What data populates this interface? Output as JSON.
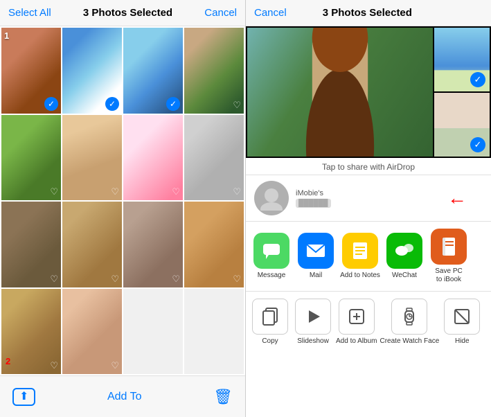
{
  "left": {
    "header": {
      "select_all": "Select All",
      "selected_count": "3 Photos Selected",
      "cancel": "Cancel"
    },
    "footer": {
      "add_to": "Add To",
      "number": "2"
    },
    "photos": [
      {
        "id": "p1",
        "selected": true,
        "heart": false,
        "number": "1"
      },
      {
        "id": "p2",
        "selected": true,
        "heart": false,
        "number": null
      },
      {
        "id": "p3",
        "selected": true,
        "heart": false,
        "number": null
      },
      {
        "id": "p4",
        "selected": false,
        "heart": true,
        "number": null
      },
      {
        "id": "p5",
        "selected": false,
        "heart": true,
        "number": null
      },
      {
        "id": "p6",
        "selected": false,
        "heart": true,
        "number": null
      },
      {
        "id": "p7",
        "selected": false,
        "heart": true,
        "number": null
      },
      {
        "id": "p8",
        "selected": false,
        "heart": true,
        "number": null
      },
      {
        "id": "p9",
        "selected": false,
        "heart": true,
        "number": null
      },
      {
        "id": "p10",
        "selected": false,
        "heart": true,
        "number": null
      },
      {
        "id": "p11",
        "selected": false,
        "heart": true,
        "number": null
      },
      {
        "id": "p12",
        "selected": false,
        "heart": true,
        "number": null
      },
      {
        "id": "p13",
        "selected": false,
        "heart": true,
        "number": null
      },
      {
        "id": "p14",
        "selected": false,
        "heart": true,
        "number": null
      }
    ]
  },
  "right": {
    "header": {
      "cancel": "Cancel",
      "selected_count": "3 Photos Selected"
    },
    "airdrop_label": "Tap to share with AirDrop",
    "contact": {
      "name": "iMobie's"
    },
    "apps": [
      {
        "id": "msg",
        "label": "Message",
        "icon": "💬"
      },
      {
        "id": "mail",
        "label": "Mail",
        "icon": "✉️"
      },
      {
        "id": "notes",
        "label": "Add to Notes",
        "icon": "📝"
      },
      {
        "id": "wechat",
        "label": "WeChat",
        "icon": "💬"
      },
      {
        "id": "ibook",
        "label": "Save PC to iBook",
        "icon": "📖"
      }
    ],
    "actions": [
      {
        "id": "copy",
        "label": "Copy",
        "icon": "⧉"
      },
      {
        "id": "slideshow",
        "label": "Slideshow",
        "icon": "▶"
      },
      {
        "id": "add-album",
        "label": "Add to Album",
        "icon": "➕"
      },
      {
        "id": "watch-face",
        "label": "Create Watch Face",
        "icon": "⌚"
      },
      {
        "id": "hide",
        "label": "Hide",
        "icon": "⊘"
      }
    ]
  }
}
